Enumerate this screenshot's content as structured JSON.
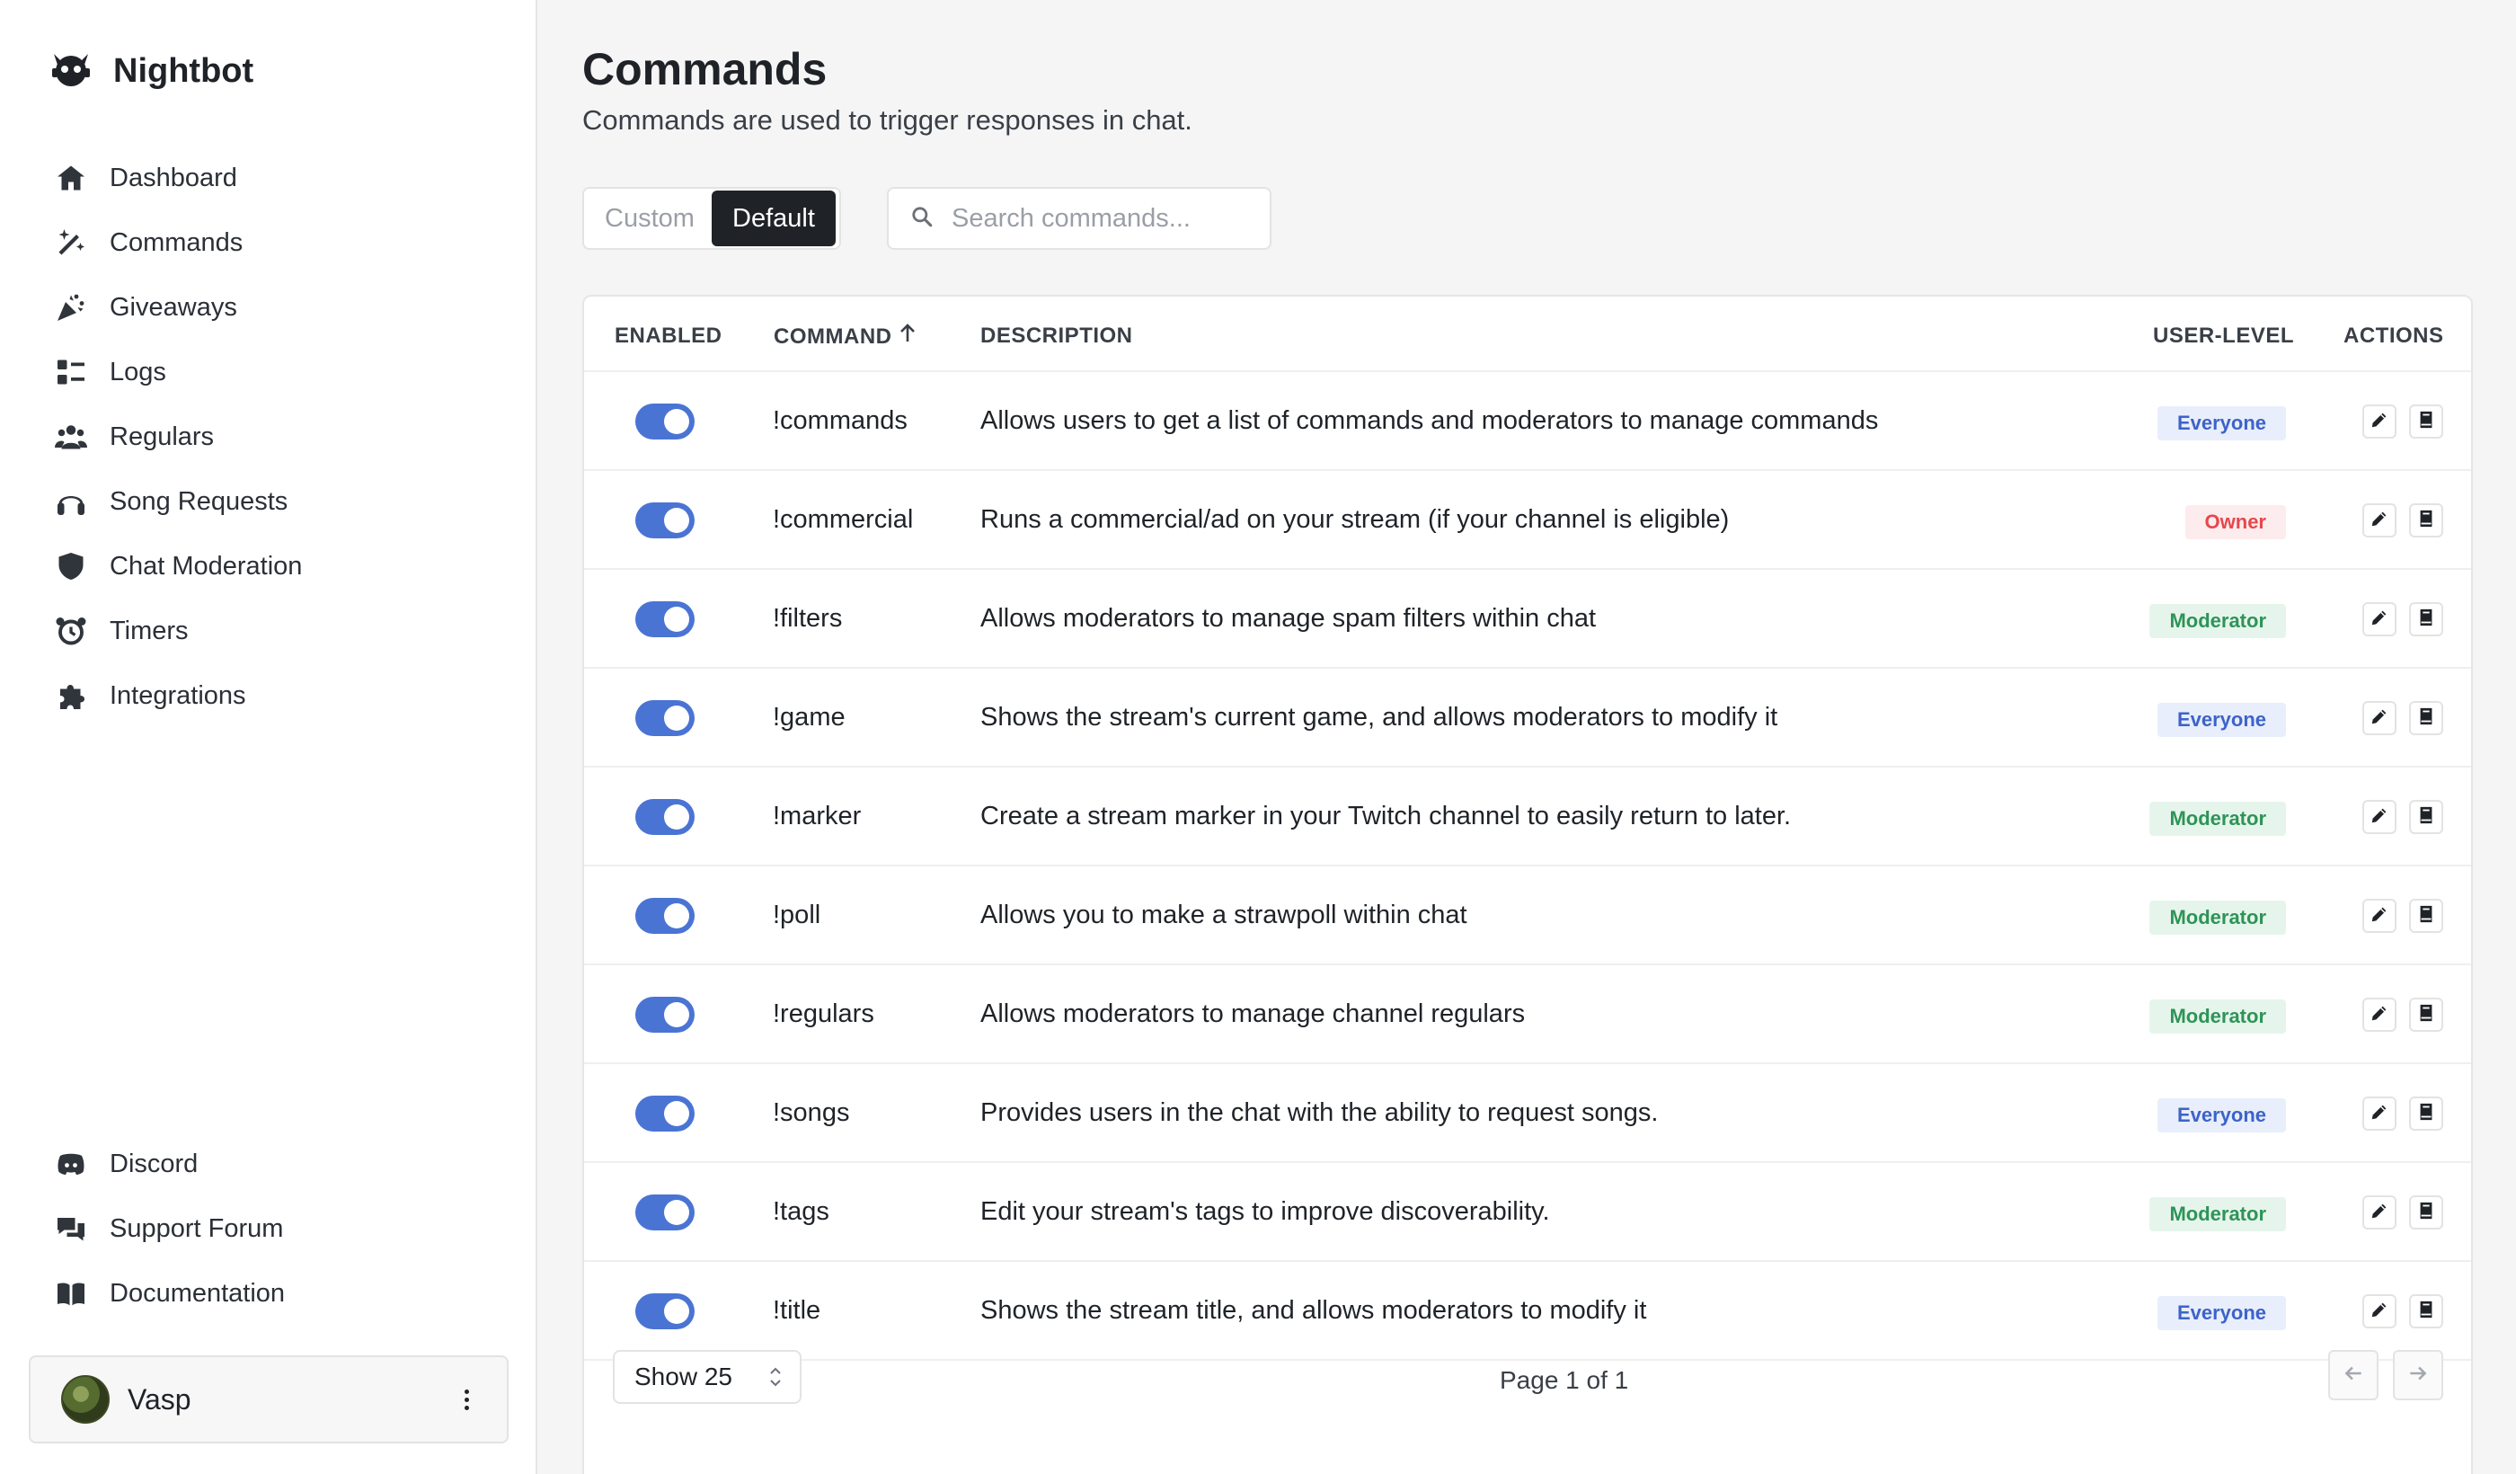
{
  "app": {
    "name": "Nightbot",
    "logo_icon": "nightbot-logo-icon"
  },
  "sidebar": {
    "nav": [
      {
        "label": "Dashboard",
        "icon": "home-icon"
      },
      {
        "label": "Commands",
        "icon": "magic-wand-icon"
      },
      {
        "label": "Giveaways",
        "icon": "party-popper-icon"
      },
      {
        "label": "Logs",
        "icon": "list-icon"
      },
      {
        "label": "Regulars",
        "icon": "users-icon"
      },
      {
        "label": "Song Requests",
        "icon": "headphones-icon"
      },
      {
        "label": "Chat Moderation",
        "icon": "shield-icon"
      },
      {
        "label": "Timers",
        "icon": "alarm-clock-icon"
      },
      {
        "label": "Integrations",
        "icon": "puzzle-icon"
      }
    ],
    "bottom_nav": [
      {
        "label": "Discord",
        "icon": "discord-icon"
      },
      {
        "label": "Support Forum",
        "icon": "chat-bubbles-icon"
      },
      {
        "label": "Documentation",
        "icon": "book-icon"
      }
    ],
    "user": {
      "name": "Vasp"
    }
  },
  "main": {
    "title": "Commands",
    "subtitle": "Commands are used to trigger responses in chat.",
    "tabs": [
      {
        "label": "Custom",
        "active": false
      },
      {
        "label": "Default",
        "active": true
      }
    ],
    "search": {
      "placeholder": "Search commands...",
      "value": ""
    },
    "table": {
      "headers": {
        "enabled": "ENABLED",
        "command": "COMMAND",
        "description": "DESCRIPTION",
        "user_level": "USER-LEVEL",
        "actions": "ACTIONS"
      },
      "sort": {
        "column": "command",
        "direction": "ascending"
      },
      "rows": [
        {
          "enabled": true,
          "command": "!commands",
          "description": "Allows users to get a list of commands and moderators to manage commands",
          "user_level": "Everyone"
        },
        {
          "enabled": true,
          "command": "!commercial",
          "description": "Runs a commercial/ad on your stream (if your channel is eligible)",
          "user_level": "Owner"
        },
        {
          "enabled": true,
          "command": "!filters",
          "description": "Allows moderators to manage spam filters within chat",
          "user_level": "Moderator"
        },
        {
          "enabled": true,
          "command": "!game",
          "description": "Shows the stream's current game, and allows moderators to modify it",
          "user_level": "Everyone"
        },
        {
          "enabled": true,
          "command": "!marker",
          "description": "Create a stream marker in your Twitch channel to easily return to later.",
          "user_level": "Moderator"
        },
        {
          "enabled": true,
          "command": "!poll",
          "description": "Allows you to make a strawpoll within chat",
          "user_level": "Moderator"
        },
        {
          "enabled": true,
          "command": "!regulars",
          "description": "Allows moderators to manage channel regulars",
          "user_level": "Moderator"
        },
        {
          "enabled": true,
          "command": "!songs",
          "description": "Provides users in the chat with the ability to request songs.",
          "user_level": "Everyone"
        },
        {
          "enabled": true,
          "command": "!tags",
          "description": "Edit your stream's tags to improve discoverability.",
          "user_level": "Moderator"
        },
        {
          "enabled": true,
          "command": "!title",
          "description": "Shows the stream title, and allows moderators to modify it",
          "user_level": "Everyone"
        }
      ]
    },
    "pagination": {
      "page_size_label": "Show 25",
      "page_label": "Page 1 of 1"
    }
  },
  "colors": {
    "toggle_on": "#4a74d4",
    "everyone": "#3d63c9",
    "owner": "#e5484d",
    "moderator": "#2e9457",
    "active_tab": "#1f2328"
  }
}
